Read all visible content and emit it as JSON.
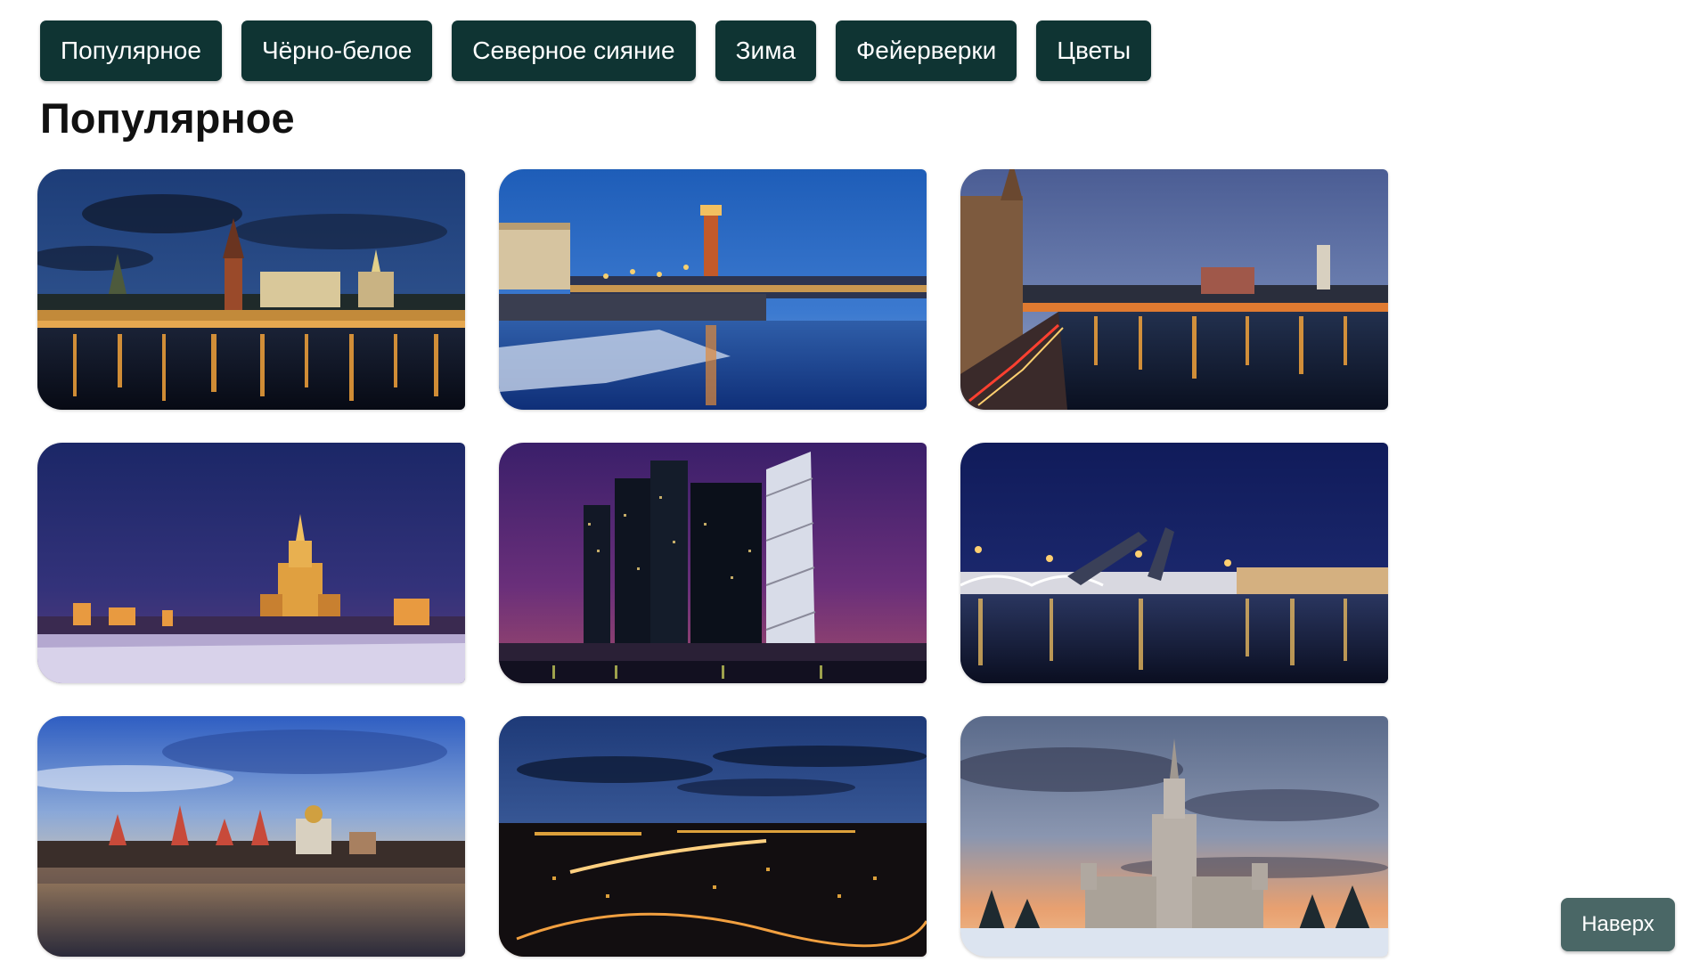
{
  "nav": {
    "buttons": [
      {
        "label": "Популярное"
      },
      {
        "label": "Чёрно-белое"
      },
      {
        "label": "Северное сияние"
      },
      {
        "label": "Зима"
      },
      {
        "label": "Фейерверки"
      },
      {
        "label": "Цветы"
      }
    ]
  },
  "section": {
    "title": "Популярное"
  },
  "gallery": {
    "photos": [
      {
        "subject": "kremlin-river-night"
      },
      {
        "subject": "rostral-column-spit"
      },
      {
        "subject": "kremlin-embankment-dusk"
      },
      {
        "subject": "stalin-highrise-winter-night"
      },
      {
        "subject": "moscow-city-skyscrapers"
      },
      {
        "subject": "drawbridge-night"
      },
      {
        "subject": "izmailovo-kremlin-sunset"
      },
      {
        "subject": "city-lights-panorama"
      },
      {
        "subject": "moscow-state-university-winter"
      }
    ]
  },
  "scroll_top": {
    "label": "Наверх"
  },
  "colors": {
    "nav_button_bg": "#0f3433",
    "scroll_top_bg": "#4a6766"
  }
}
